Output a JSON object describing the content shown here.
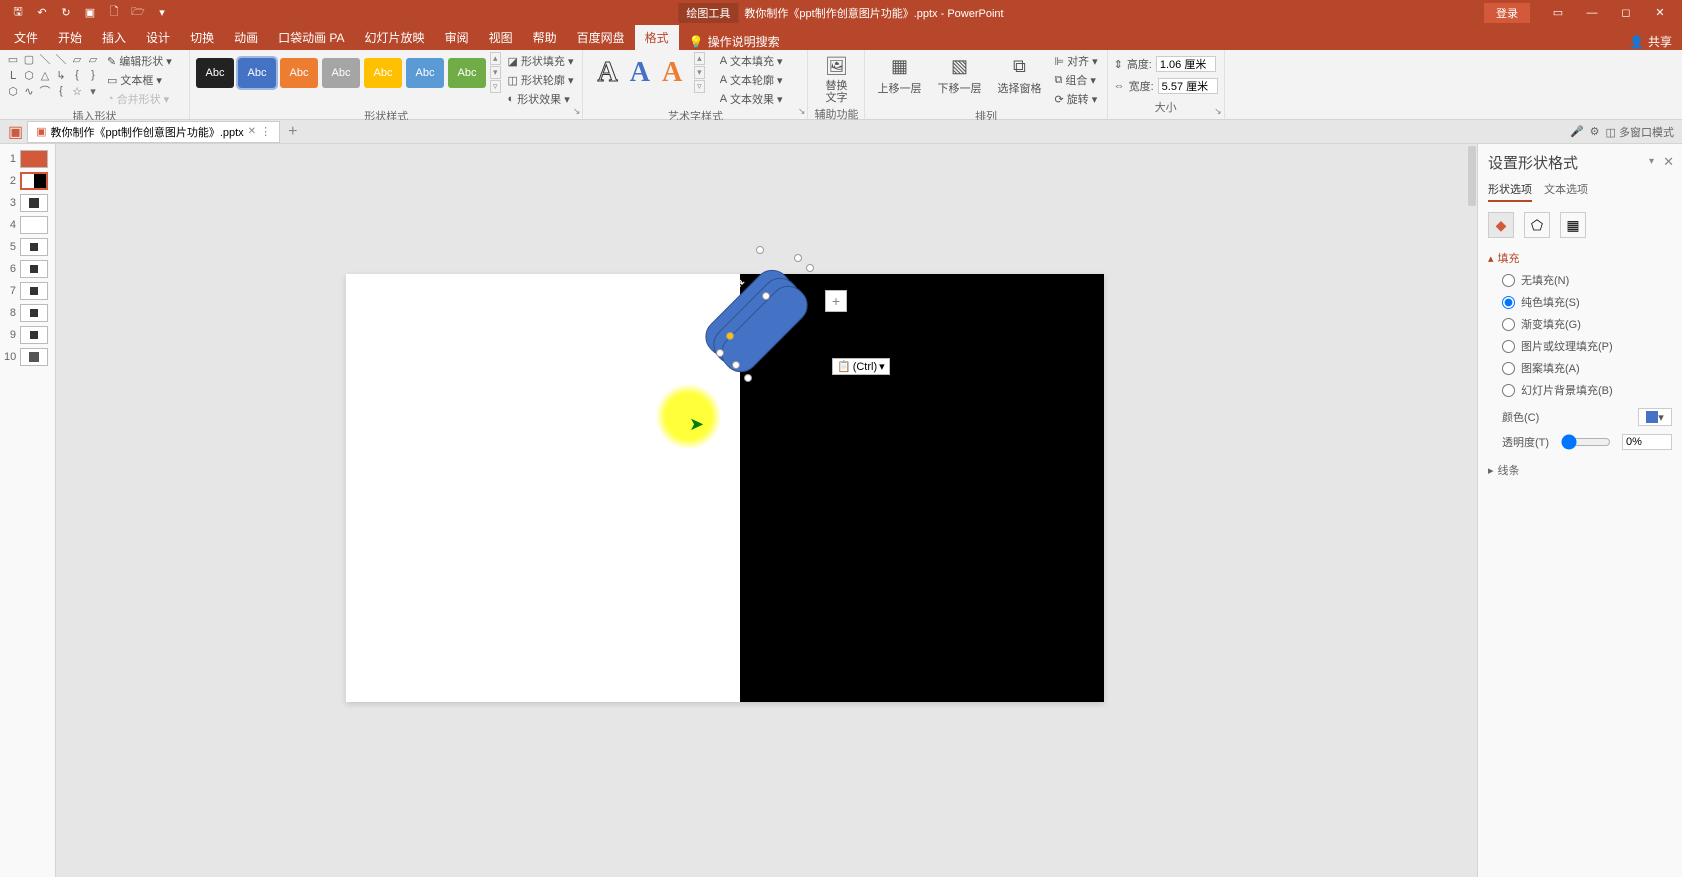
{
  "titlebar": {
    "contextual": "绘图工具",
    "filename": "教你制作《ppt制作创意图片功能》.pptx - PowerPoint",
    "login": "登录"
  },
  "menus": {
    "file": "文件",
    "home": "开始",
    "insert": "插入",
    "design": "设计",
    "transitions": "切换",
    "animations": "动画",
    "pocket": "口袋动画 PA",
    "slideshow": "幻灯片放映",
    "review": "审阅",
    "view": "视图",
    "help": "帮助",
    "baidu": "百度网盘",
    "format": "格式",
    "tellme": "操作说明搜索",
    "share": "共享"
  },
  "ribbon": {
    "insert_shapes": {
      "edit_shape": "编辑形状",
      "text_box": "文本框",
      "merge_shapes": "合并形状",
      "label": "插入形状"
    },
    "shape_styles": {
      "abc": "Abc",
      "shape_fill": "形状填充",
      "shape_outline": "形状轮廓",
      "shape_effects": "形状效果",
      "label": "形状样式"
    },
    "wordart": {
      "letter": "A",
      "text_fill": "文本填充",
      "text_outline": "文本轮廓",
      "text_effects": "文本效果",
      "label": "艺术字样式"
    },
    "accessibility": {
      "alt_text": "替换\n文字",
      "label": "辅助功能"
    },
    "arrange": {
      "bring_forward": "上移一层",
      "send_backward": "下移一层",
      "selection_pane": "选择窗格",
      "align": "对齐",
      "group": "组合",
      "rotate": "旋转",
      "label": "排列"
    },
    "size": {
      "height_label": "高度:",
      "height_val": "1.06 厘米",
      "width_label": "宽度:",
      "width_val": "5.57 厘米",
      "label": "大小"
    }
  },
  "doctab": {
    "name": "教你制作《ppt制作创意图片功能》.pptx",
    "multiwindow": "多窗口模式"
  },
  "thumbs": [
    "1",
    "2",
    "3",
    "4",
    "5",
    "6",
    "7",
    "8",
    "9",
    "10"
  ],
  "canvas": {
    "paste_ctrl": "(Ctrl)"
  },
  "pane": {
    "title": "设置形状格式",
    "tab_shape": "形状选项",
    "tab_text": "文本选项",
    "fill_header": "填充",
    "line_header": "线条",
    "fill_none": "无填充(N)",
    "fill_solid": "纯色填充(S)",
    "fill_gradient": "渐变填充(G)",
    "fill_picture": "图片或纹理填充(P)",
    "fill_pattern": "图案填充(A)",
    "fill_slidebg": "幻灯片背景填充(B)",
    "color_label": "颜色(C)",
    "transparency_label": "透明度(T)",
    "transparency_val": "0%"
  }
}
